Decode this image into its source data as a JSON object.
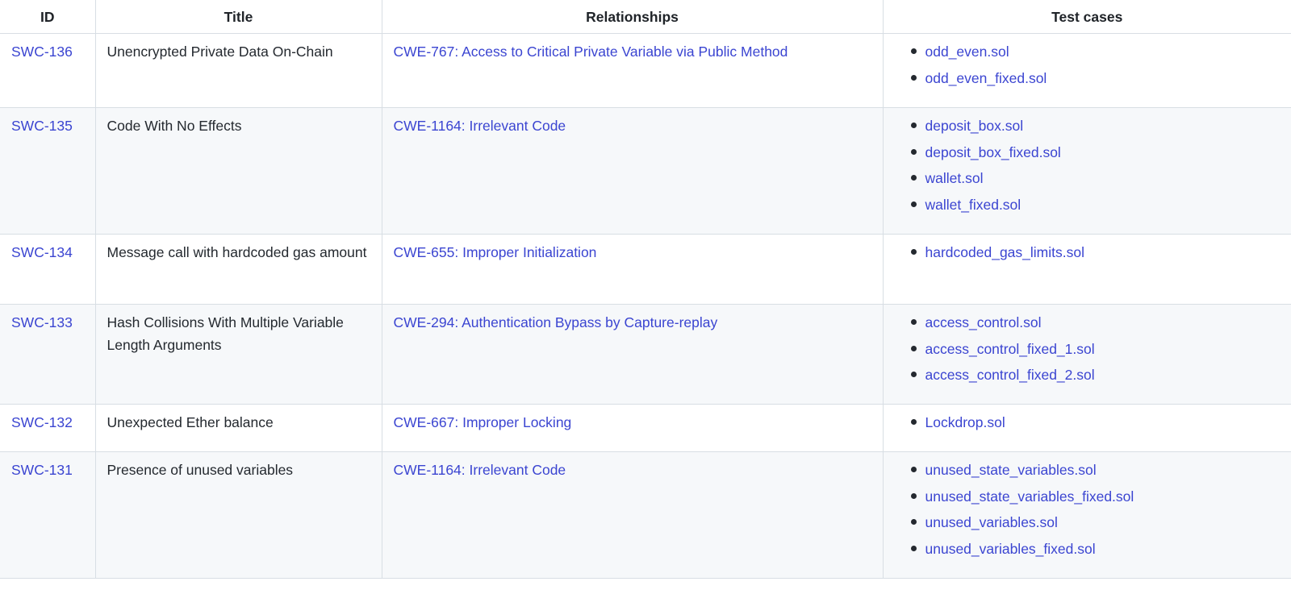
{
  "table": {
    "headers": {
      "id": "ID",
      "title": "Title",
      "relationships": "Relationships",
      "test_cases": "Test cases"
    },
    "rows": [
      {
        "id": "SWC-136",
        "title": "Unencrypted Private Data On-Chain",
        "relationship": "CWE-767: Access to Critical Private Variable via Public Method",
        "tests": [
          "odd_even.sol",
          "odd_even_fixed.sol"
        ]
      },
      {
        "id": "SWC-135",
        "title": "Code With No Effects",
        "relationship": "CWE-1164: Irrelevant Code",
        "tests": [
          "deposit_box.sol",
          "deposit_box_fixed.sol",
          "wallet.sol",
          "wallet_fixed.sol"
        ]
      },
      {
        "id": "SWC-134",
        "title": "Message call with hardcoded gas amount",
        "relationship": "CWE-655: Improper Initialization",
        "tests": [
          "hardcoded_gas_limits.sol"
        ]
      },
      {
        "id": "SWC-133",
        "title": "Hash Collisions With Multiple Variable Length Arguments",
        "relationship": "CWE-294: Authentication Bypass by Capture-replay",
        "tests": [
          "access_control.sol",
          "access_control_fixed_1.sol",
          "access_control_fixed_2.sol"
        ]
      },
      {
        "id": "SWC-132",
        "title": "Unexpected Ether balance",
        "relationship": "CWE-667: Improper Locking",
        "tests": [
          "Lockdrop.sol"
        ]
      },
      {
        "id": "SWC-131",
        "title": "Presence of unused variables",
        "relationship": "CWE-1164: Irrelevant Code",
        "tests": [
          "unused_state_variables.sol",
          "unused_state_variables_fixed.sol",
          "unused_variables.sol",
          "unused_variables_fixed.sol"
        ]
      }
    ]
  },
  "colors": {
    "link": "#3b45d1",
    "text": "#24292f",
    "border": "#d8dee4",
    "stripe": "#f6f8fa"
  }
}
